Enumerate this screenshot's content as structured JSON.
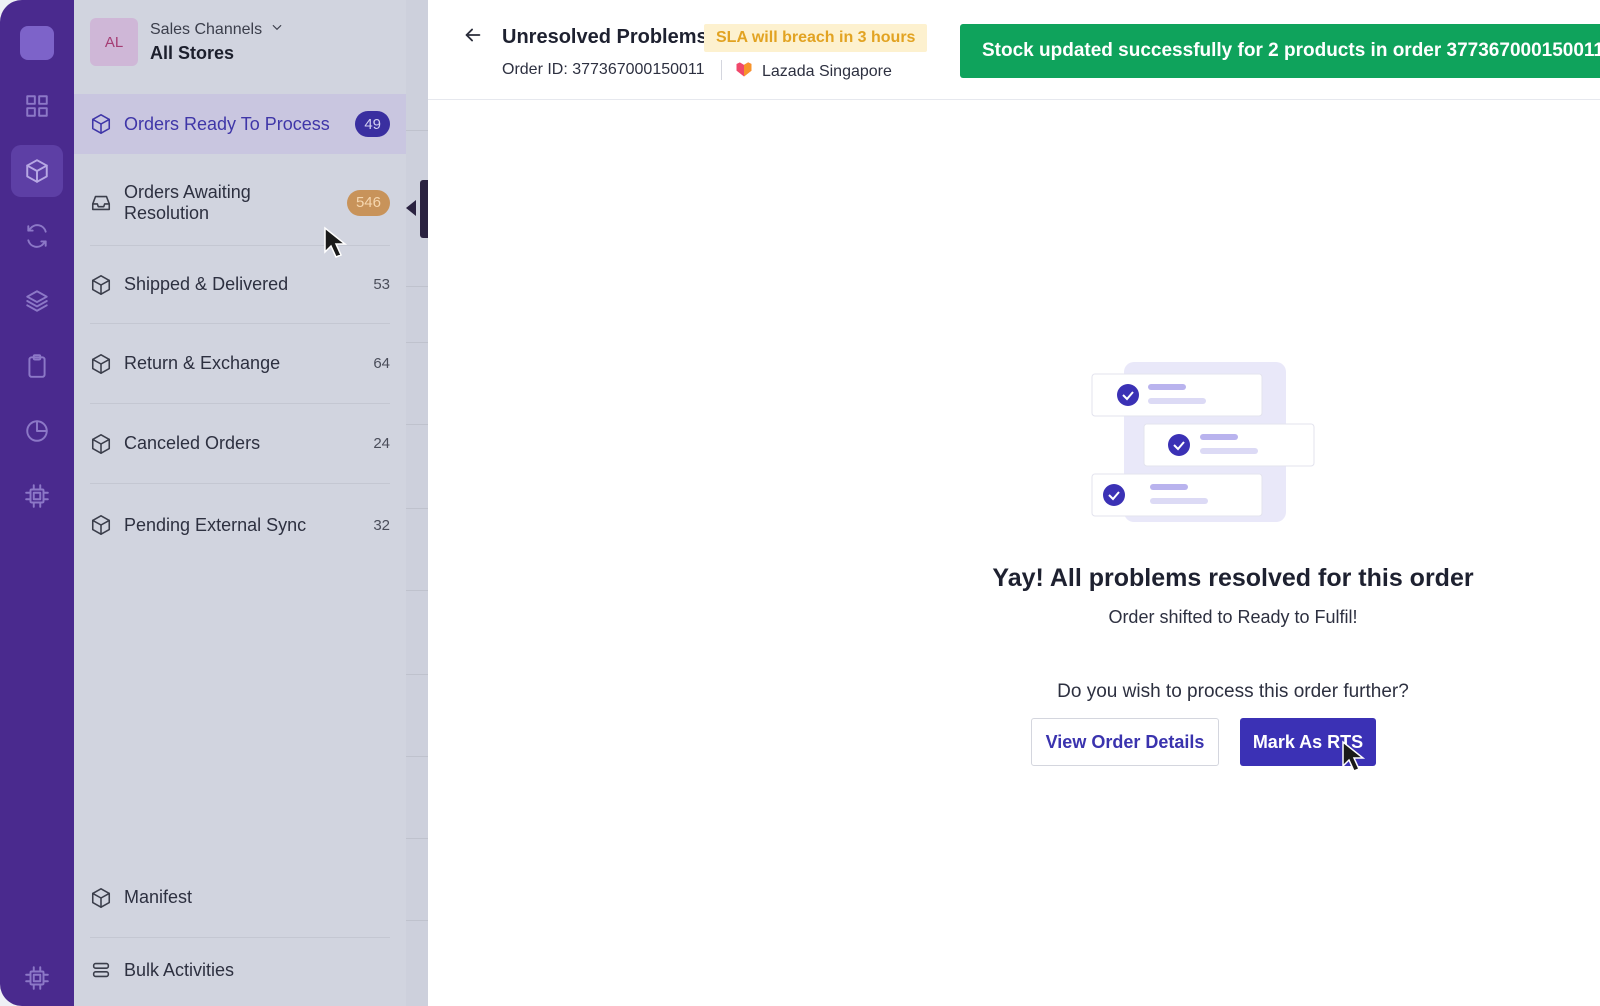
{
  "rail": {
    "icons": [
      "dashboard-icon",
      "package-icon",
      "sync-icon",
      "layers-icon",
      "clipboard-icon",
      "pie-chart-icon",
      "chip-icon",
      "chip-icon"
    ]
  },
  "store": {
    "avatar_initials": "AL",
    "channels_label": "Sales Channels",
    "store_name": "All Stores"
  },
  "sidebar": {
    "items": [
      {
        "label": "Orders Ready To Process",
        "count": "49",
        "icon": "package-icon"
      },
      {
        "label": "Orders Awaiting Resolution",
        "count": "546",
        "icon": "inbox-icon"
      },
      {
        "label": "Shipped & Delivered",
        "count": "53",
        "icon": "package-icon"
      },
      {
        "label": "Return & Exchange",
        "count": "64",
        "icon": "package-icon"
      },
      {
        "label": "Canceled Orders",
        "count": "24",
        "icon": "package-icon"
      },
      {
        "label": "Pending External Sync",
        "count": "32",
        "icon": "package-icon"
      }
    ],
    "bottom_items": [
      {
        "label": "Manifest",
        "icon": "package-icon"
      },
      {
        "label": "Bulk Activities",
        "icon": "stack-icon"
      }
    ]
  },
  "panel": {
    "title": "Unresolved Problems",
    "sla_badge": "SLA will breach in 3 hours",
    "order_id": "Order ID: 377367000150011",
    "marketplace": "Lazada Singapore",
    "toast": "Stock updated successfully for 2 products in order 377367000150011"
  },
  "result": {
    "headline": "Yay! All problems resolved for this order",
    "subline": "Order shifted to Ready to Fulfil!",
    "question": "Do you wish to process this order further?",
    "view_details_label": "View Order Details",
    "mark_rts_label": "Mark As RTS"
  },
  "colors": {
    "rail": "#4a2a8e",
    "primary": "#3b31b5",
    "success_toast": "#0fa35c",
    "sla_text": "#e2a322",
    "sla_bg": "#fdf1cf"
  }
}
